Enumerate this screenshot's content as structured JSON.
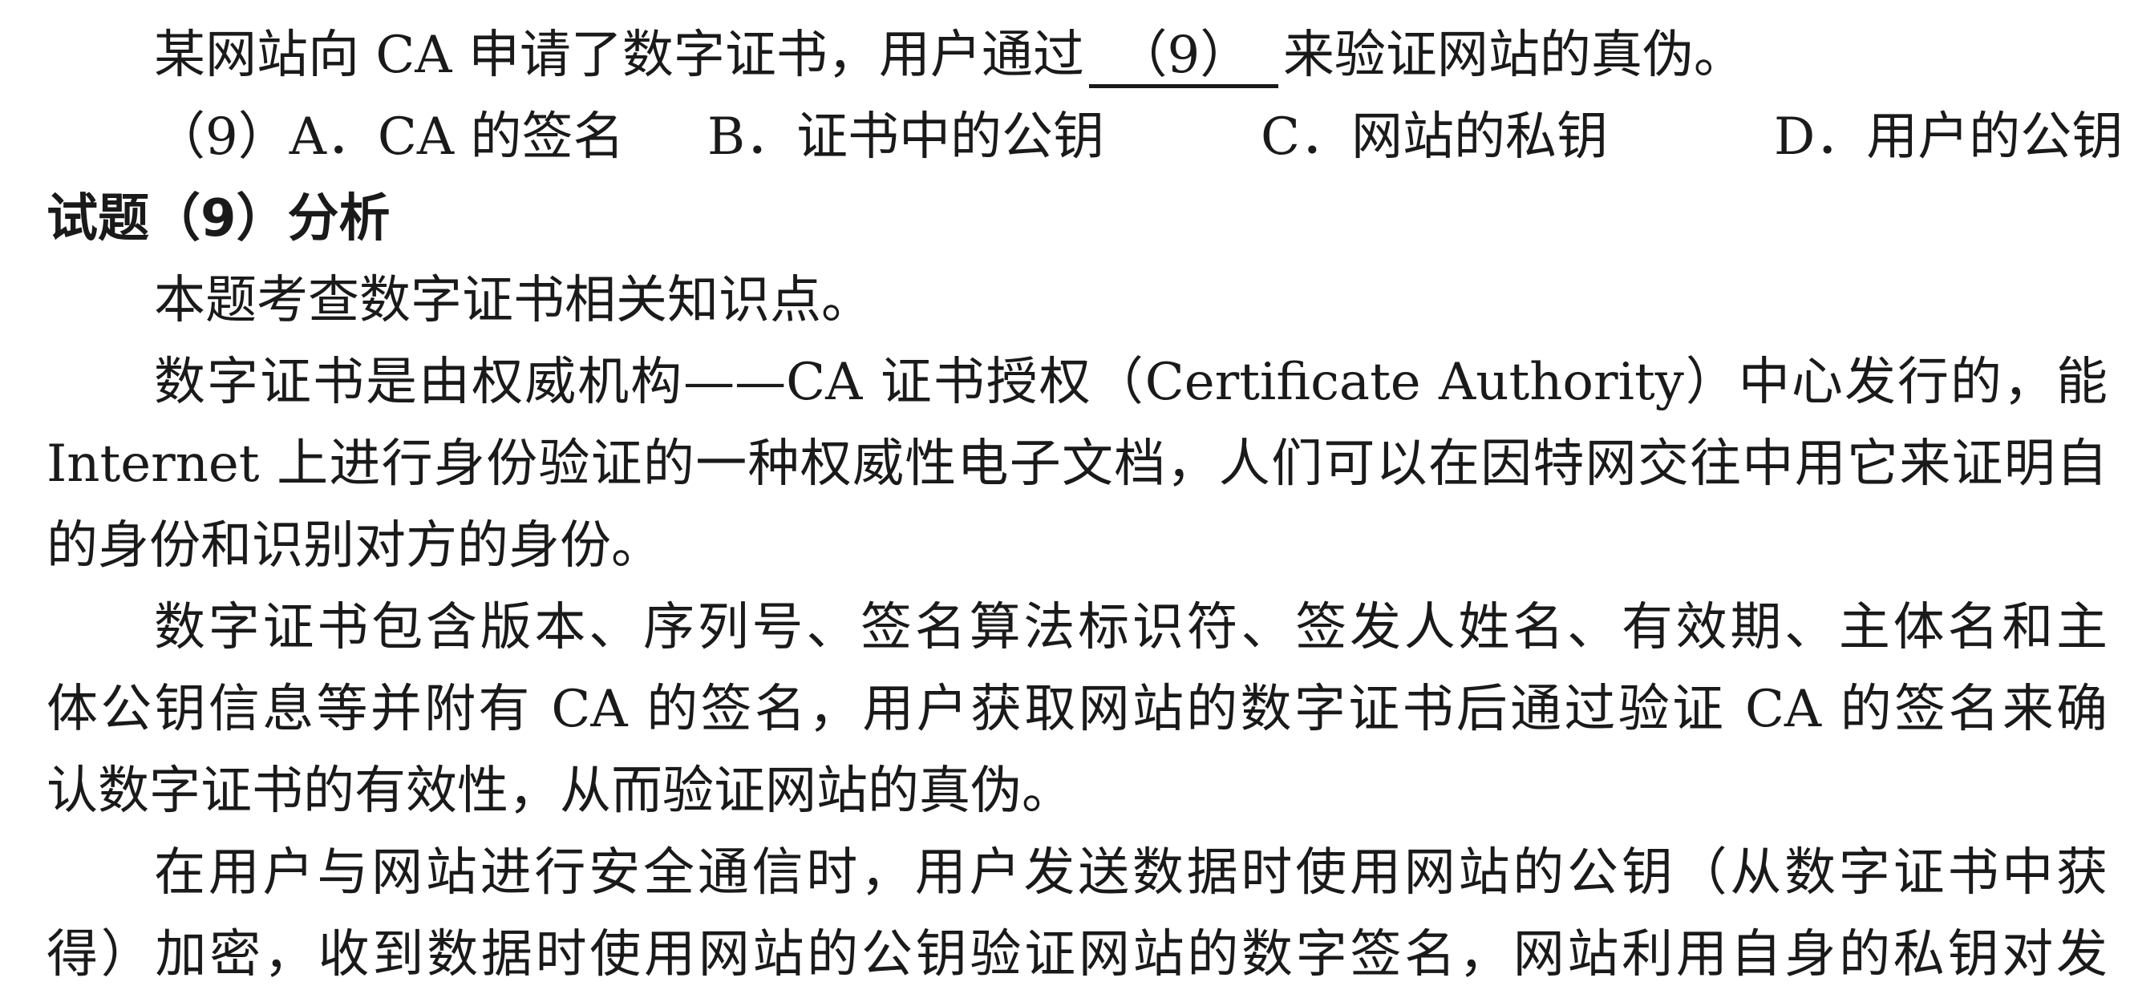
{
  "question": {
    "stem_before": "某网站向 CA 申请了数字证书，用户通过",
    "blank": "（9）",
    "stem_after": "来验证网站的真伪。",
    "options": [
      {
        "label": "（9）A．CA 的签名"
      },
      {
        "label": "B．证书中的公钥"
      },
      {
        "label": "C．网站的私钥"
      },
      {
        "label": "D．用户的公钥"
      }
    ]
  },
  "analysis": {
    "heading": "试题（9）分析",
    "lines": [
      "本题考查数字证书相关知识点。",
      "数字证书是由权威机构——CA 证书授权（Certificate Authority）中心发行的，能提供在",
      "Internet 上进行身份验证的一种权威性电子文档，人们可以在因特网交往中用它来证明自己",
      "的身份和识别对方的身份。",
      "数字证书包含版本、序列号、签名算法标识符、签发人姓名、有效期、主体名和主",
      "体公钥信息等并附有 CA 的签名，用户获取网站的数字证书后通过验证 CA 的签名来确",
      "认数字证书的有效性，从而验证网站的真伪。",
      "在用户与网站进行安全通信时，用户发送数据时使用网站的公钥（从数字证书中获",
      "得）加密，收到数据时使用网站的公钥验证网站的数字签名，网站利用自身的私钥对发"
    ]
  }
}
